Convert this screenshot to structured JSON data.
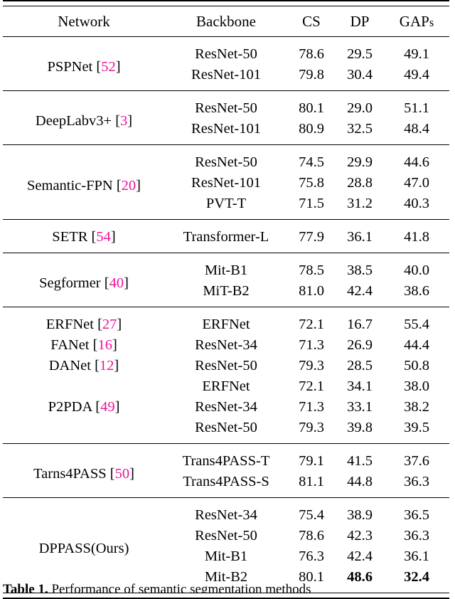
{
  "table": {
    "headers": {
      "network": "Network",
      "backbone": "Backbone",
      "cs": "CS",
      "dp": "DP",
      "gaps": "GAPs"
    },
    "citation_color": "#f0119b",
    "sections": [
      {
        "network": "PSPNet",
        "citation": "52",
        "rows": [
          {
            "backbone": "ResNet-50",
            "cs": "78.6",
            "dp": "29.5",
            "gaps": "49.1"
          },
          {
            "backbone": "ResNet-101",
            "cs": "79.8",
            "dp": "30.4",
            "gaps": "49.4"
          }
        ]
      },
      {
        "network": "DeepLabv3+",
        "citation": "3",
        "rows": [
          {
            "backbone": "ResNet-50",
            "cs": "80.1",
            "dp": "29.0",
            "gaps": "51.1"
          },
          {
            "backbone": "ResNet-101",
            "cs": "80.9",
            "dp": "32.5",
            "gaps": "48.4"
          }
        ]
      },
      {
        "network": "Semantic-FPN",
        "citation": "20",
        "rows": [
          {
            "backbone": "ResNet-50",
            "cs": "74.5",
            "dp": "29.9",
            "gaps": "44.6"
          },
          {
            "backbone": "ResNet-101",
            "cs": "75.8",
            "dp": "28.8",
            "gaps": "47.0"
          },
          {
            "backbone": "PVT-T",
            "cs": "71.5",
            "dp": "31.2",
            "gaps": "40.3"
          }
        ]
      },
      {
        "network": "SETR ",
        "citation": "54",
        "rows": [
          {
            "backbone": "Transformer-L",
            "cs": "77.9",
            "dp": "36.1",
            "gaps": "41.8"
          }
        ]
      },
      {
        "network": "Segformer",
        "citation": "40",
        "rows": [
          {
            "backbone": "Mit-B1",
            "cs": "78.5",
            "dp": "38.5",
            "gaps": "40.0"
          },
          {
            "backbone": "MiT-B2",
            "cs": "81.0",
            "dp": "42.4",
            "gaps": "38.6"
          }
        ]
      },
      {
        "multi_label": true,
        "rows": [
          {
            "network": "ERFNet",
            "citation": "27",
            "backbone": "ERFNet",
            "cs": "72.1",
            "dp": "16.7",
            "gaps": "55.4"
          },
          {
            "network": "FANet",
            "citation": "16",
            "backbone": "ResNet-34",
            "cs": "71.3",
            "dp": "26.9",
            "gaps": "44.4"
          },
          {
            "network": "DANet",
            "citation": "12",
            "backbone": "ResNet-50",
            "cs": "79.3",
            "dp": "28.5",
            "gaps": "50.8"
          },
          {
            "network": "",
            "backbone": "ERFNet",
            "cs": "72.1",
            "dp": "34.1",
            "gaps": "38.0"
          },
          {
            "network": "P2PDA ",
            "citation": "49",
            "backbone": "ResNet-34",
            "cs": "71.3",
            "dp": "33.1",
            "gaps": "38.2"
          },
          {
            "network": "",
            "backbone": "ResNet-50",
            "cs": "79.3",
            "dp": "39.8",
            "gaps": "39.5"
          }
        ]
      },
      {
        "network": "Tarns4PASS",
        "citation": "50",
        "rows": [
          {
            "backbone": "Trans4PASS-T",
            "cs": "79.1",
            "dp": "41.5",
            "gaps": "37.6"
          },
          {
            "backbone": "Trans4PASS-S",
            "cs": "81.1",
            "dp": "44.8",
            "gaps": "36.3"
          }
        ]
      },
      {
        "network": "DPPASS(Ours)",
        "citation": null,
        "rows": [
          {
            "backbone": "ResNet-34",
            "cs": "75.4",
            "dp": "38.9",
            "gaps": "36.5"
          },
          {
            "backbone": "ResNet-50",
            "cs": "78.6",
            "dp": "42.3",
            "gaps": "36.3"
          },
          {
            "backbone": "Mit-B1",
            "cs": "76.3",
            "dp": "42.4",
            "gaps": "36.1"
          },
          {
            "backbone": "Mit-B2",
            "cs": "80.1",
            "dp": "48.6",
            "gaps": "32.4",
            "dp_bold": true,
            "gaps_bold": true
          }
        ]
      }
    ]
  },
  "caption": {
    "label": "Table 1.",
    "text": "Performance of semantic segmentation methods"
  }
}
